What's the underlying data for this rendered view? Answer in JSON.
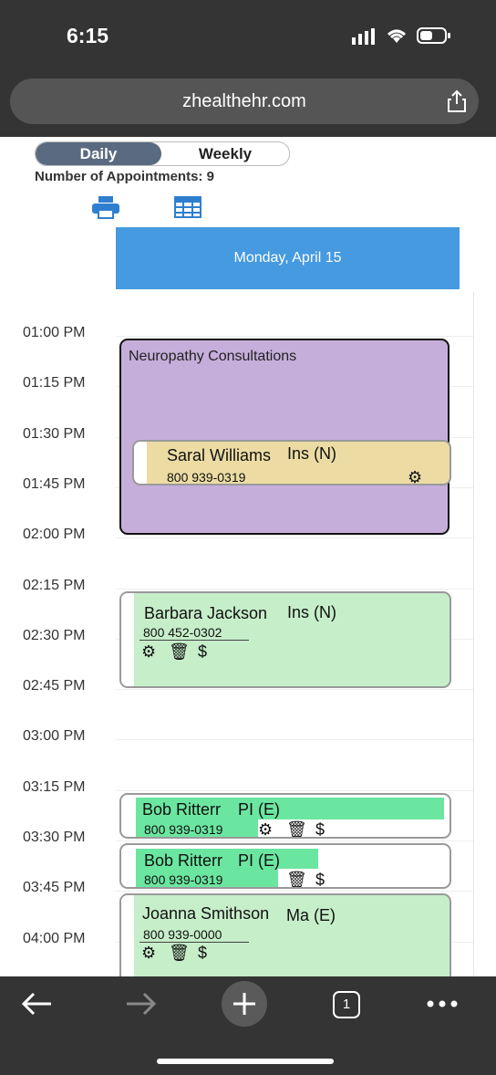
{
  "status": {
    "time": "6:15"
  },
  "browser": {
    "url": "zhealthehr.com"
  },
  "view_toggle": {
    "daily": "Daily",
    "weekly": "Weekly",
    "selected": "Daily"
  },
  "appointments_count": "Number of Appointments: 9",
  "date_header": "Monday, April 15",
  "time_slots": [
    "01:00 PM",
    "01:15 PM",
    "01:30 PM",
    "01:45 PM",
    "02:00 PM",
    "02:15 PM",
    "02:30 PM",
    "02:45 PM",
    "03:00 PM",
    "03:15 PM",
    "03:30 PM",
    "03:45 PM",
    "04:00 PM"
  ],
  "block": {
    "title": "Neuropathy Consultations",
    "color": "#c6aedb"
  },
  "appointments": [
    {
      "name": "Saral Williams",
      "type": "Ins (N)",
      "phone": "800 939-0319",
      "color": "#ecdca4"
    },
    {
      "name": "Barbara Jackson",
      "type": "Ins (N)",
      "phone": "800 452-0302",
      "color": "#c6eec9"
    },
    {
      "name": "Bob Ritterr",
      "type": "PI (E)",
      "phone": "800 939-0319",
      "color": "#6be6a0"
    },
    {
      "name": "Bob Ritterr",
      "type": "PI (E)",
      "phone": "800 939-0319",
      "color": "#6be6a0"
    },
    {
      "name": "Joanna Smithson",
      "type": "Ma (E)",
      "phone": "800 939-0000",
      "color": "#c6eec9"
    }
  ],
  "icons": {
    "settings": "gear-icon",
    "delete": "trash-icon",
    "billing": "dollar-icon",
    "print": "printer-icon",
    "calendar": "calendar-grid-icon"
  },
  "actions": {
    "dollar": "$"
  },
  "toolbar": {
    "tabs_count": "1"
  },
  "colors": {
    "accent": "#459ae0",
    "segment_selected": "#5a6a80",
    "chrome": "#343434"
  }
}
